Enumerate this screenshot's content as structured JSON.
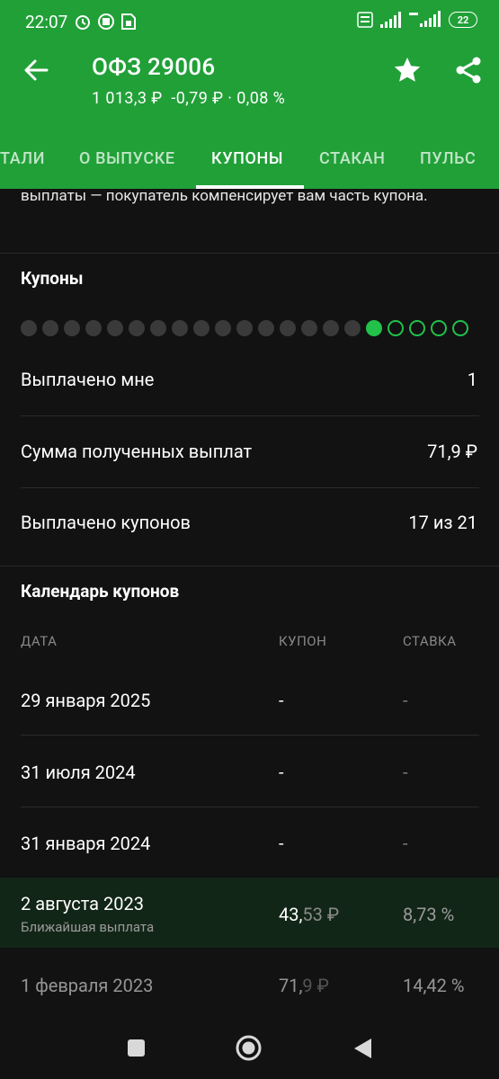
{
  "status_bar": {
    "time": "22:07",
    "battery": "22"
  },
  "header": {
    "title": "ОФЗ 29006",
    "price": "1 013,3 ₽",
    "change": "-0,79 ₽ · 0,08 %"
  },
  "tabs": [
    {
      "label": "ТАЛИ"
    },
    {
      "label": "О ВЫПУСКЕ"
    },
    {
      "label": "КУПОНЫ"
    },
    {
      "label": "СТАКАН"
    },
    {
      "label": "ПУЛЬС"
    }
  ],
  "intro_text": "выплаты — покупатель компенсирует вам часть купона.",
  "coupons": {
    "title": "Купоны",
    "paid_count": 17,
    "total_count": 21,
    "rows": [
      {
        "label": "Выплачено мне",
        "value": "1"
      },
      {
        "label": "Сумма полученных выплат",
        "value": "71,9 ₽"
      },
      {
        "label": "Выплачено купонов",
        "value": "17 из 21"
      }
    ]
  },
  "calendar": {
    "title": "Календарь купонов",
    "headers": {
      "date": "ДАТА",
      "coupon": "КУПОН",
      "rate": "СТАВКА"
    },
    "rows": [
      {
        "date": "29 января 2025",
        "coupon": "-",
        "rate": "-"
      },
      {
        "date": "31 июля 2024",
        "coupon": "-",
        "rate": "-"
      },
      {
        "date": "31 января 2024",
        "coupon": "-",
        "rate": "-"
      },
      {
        "date": "2 августа 2023",
        "coupon_int": "43,",
        "coupon_frac": "53 ₽",
        "rate": "8,73 %",
        "note": "Ближайшая выплата"
      },
      {
        "date": "1 февраля 2023",
        "coupon_int": "71,",
        "coupon_frac": "9 ₽",
        "rate": "14,42 %"
      }
    ]
  }
}
